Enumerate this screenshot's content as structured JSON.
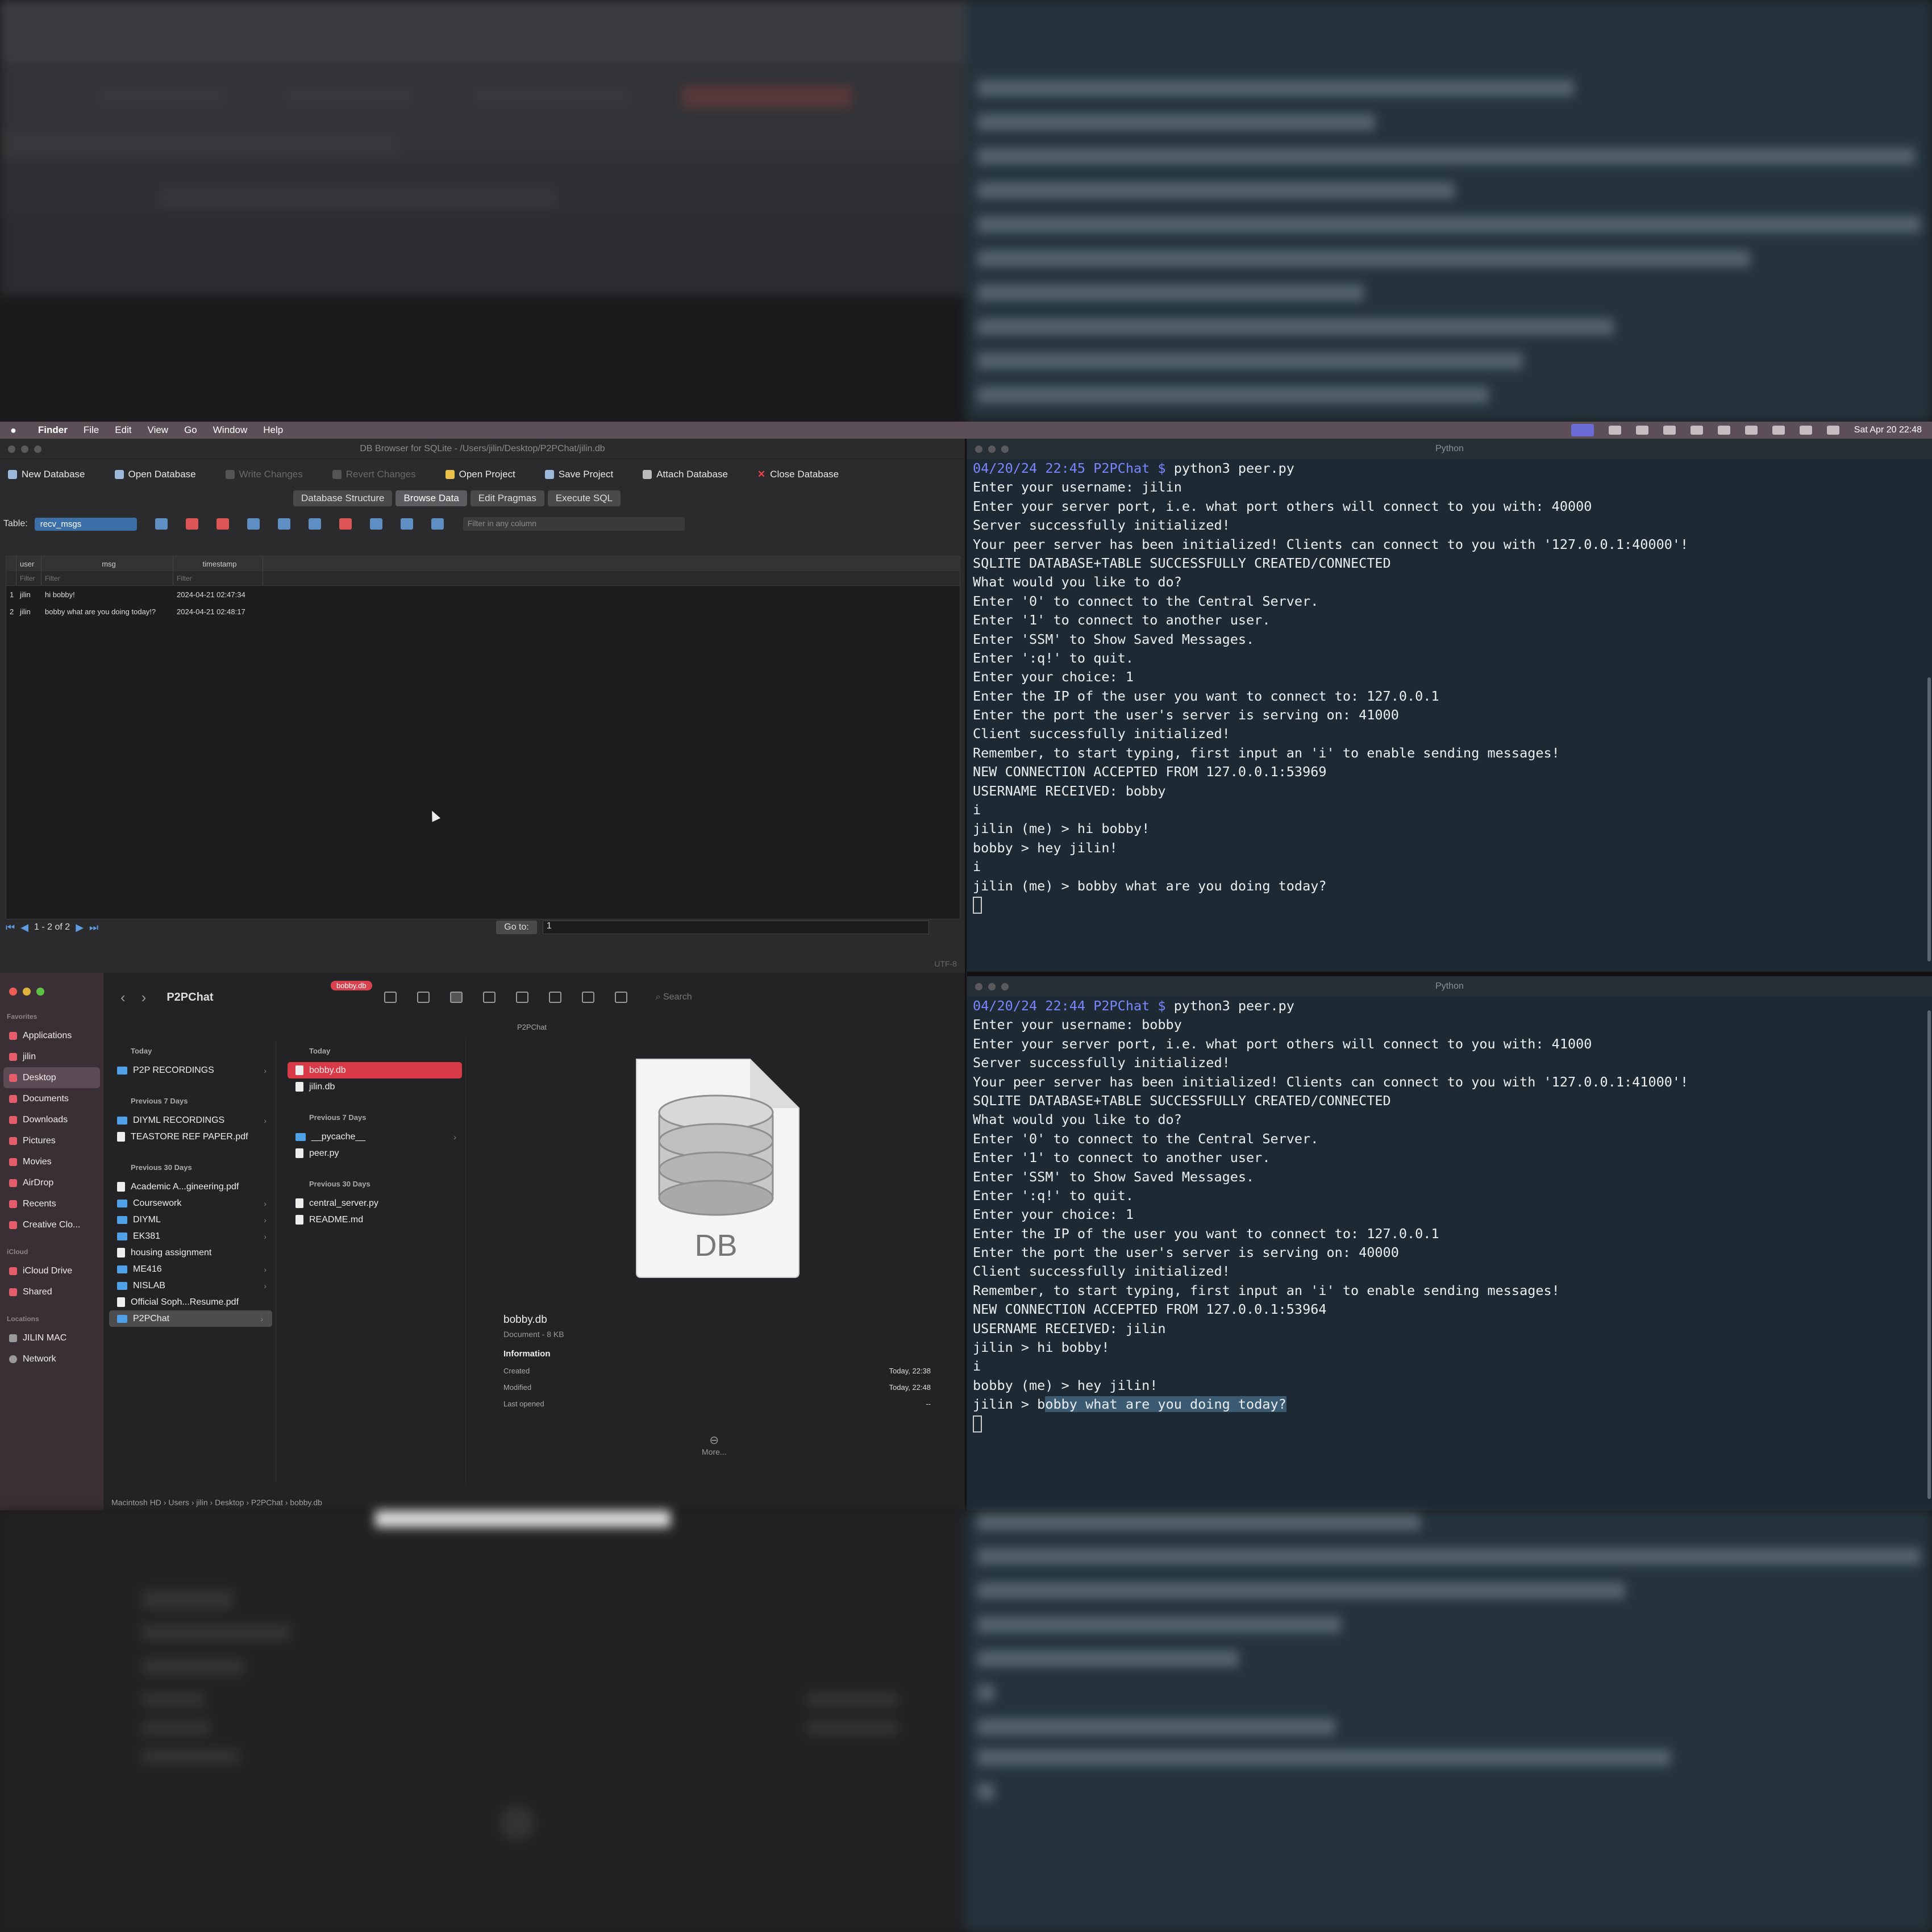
{
  "menubar": {
    "app": "Finder",
    "items": [
      "File",
      "Edit",
      "View",
      "Go",
      "Window",
      "Help"
    ],
    "datetime": "Sat Apr 20  22:48"
  },
  "db_browser": {
    "title": "DB Browser for SQLite - /Users/jilin/Desktop/P2PChat/jilin.db",
    "toolbar": [
      {
        "label": "New Database",
        "enabled": true
      },
      {
        "label": "Open Database",
        "enabled": true
      },
      {
        "label": "Write Changes",
        "enabled": false
      },
      {
        "label": "Revert Changes",
        "enabled": false
      },
      {
        "label": "Open Project",
        "enabled": true
      },
      {
        "label": "Save Project",
        "enabled": true
      },
      {
        "label": "Attach Database",
        "enabled": true
      },
      {
        "label": "Close Database",
        "enabled": true
      }
    ],
    "tabs": [
      "Database Structure",
      "Browse Data",
      "Edit Pragmas",
      "Execute SQL"
    ],
    "table_label": "Table:",
    "table_value": "recv_msgs",
    "filter_placeholder": "Filter in any column",
    "columns": [
      "user",
      "msg",
      "timestamp"
    ],
    "filter_cells": [
      "Filter",
      "Filter",
      "Filter"
    ],
    "rows": [
      {
        "n": "1",
        "user": "jilin",
        "msg": "hi bobby!",
        "timestamp": "2024-04-21 02:47:34"
      },
      {
        "n": "2",
        "user": "jilin",
        "msg": "bobby what are you doing today!?",
        "timestamp": "2024-04-21 02:48:17"
      }
    ],
    "pagination": "1 - 2 of 2",
    "goto_label": "Go to:",
    "goto_value": "1",
    "encoding": "UTF-8"
  },
  "finder": {
    "folder_title": "P2PChat",
    "tag": "bobby.db",
    "search_placeholder": "Search",
    "path_title": "P2PChat",
    "sidebar": {
      "favorites_label": "Favorites",
      "favorites": [
        "Applications",
        "jilin",
        "Desktop",
        "Documents",
        "Downloads",
        "Pictures",
        "Movies",
        "AirDrop",
        "Recents",
        "Creative Clo..."
      ],
      "icloud_label": "iCloud",
      "icloud": [
        "iCloud Drive",
        "Shared"
      ],
      "locations_label": "Locations",
      "locations": [
        "JILIN MAC",
        "Network"
      ]
    },
    "col1": {
      "today_label": "Today",
      "today": [
        "P2P RECORDINGS"
      ],
      "prev7_label": "Previous 7 Days",
      "prev7": [
        "DIYML RECORDINGS",
        "TEASTORE REF PAPER.pdf"
      ],
      "prev30_label": "Previous 30 Days",
      "prev30": [
        "Academic A...gineering.pdf",
        "Coursework",
        "DIYML",
        "EK381",
        "housing assignment",
        "ME416",
        "NISLAB",
        "Official Soph...Resume.pdf",
        "P2PChat"
      ]
    },
    "col2": {
      "today_label": "Today",
      "today": [
        "bobby.db",
        "jilin.db"
      ],
      "prev7_label": "Previous 7 Days",
      "prev7": [
        "__pycache__",
        "peer.py"
      ],
      "prev30_label": "Previous 30 Days",
      "prev30": [
        "central_server.py",
        "README.md"
      ]
    },
    "preview": {
      "icon_text": "DB",
      "name": "bobby.db",
      "kind": "Document - 8 KB",
      "info_label": "Information",
      "created_label": "Created",
      "created": "Today, 22:38",
      "modified_label": "Modified",
      "modified": "Today, 22:48",
      "opened_label": "Last opened",
      "opened": "--",
      "more": "More..."
    },
    "pathbar": [
      "Macintosh HD",
      "Users",
      "jilin",
      "Desktop",
      "P2PChat",
      "bobby.db"
    ]
  },
  "terminal1": {
    "title": "Python",
    "prompt": "04/20/24 22:45 P2PChat $",
    "command": " python3 peer.py",
    "lines": [
      "Enter your username: jilin",
      "Enter your server port, i.e. what port others will connect to you with: 40000",
      "Server successfully initialized!",
      "Your peer server has been initialized! Clients can connect to you with '127.0.0.1:40000'!",
      "SQLITE DATABASE+TABLE SUCCESSFULLY CREATED/CONNECTED",
      "What would you like to do?",
      "Enter '0' to connect to the Central Server.",
      "Enter '1' to connect to another user.",
      "Enter 'SSM' to Show Saved Messages.",
      "Enter ':q!' to quit.",
      "Enter your choice: 1",
      "Enter the IP of the user you want to connect to: 127.0.0.1",
      "Enter the port the user's server is serving on: 41000",
      "Client successfully initialized!",
      "Remember, to start typing, first input an 'i' to enable sending messages!",
      "NEW CONNECTION ACCEPTED FROM 127.0.0.1:53969",
      "USERNAME RECEIVED: bobby",
      "i",
      "jilin (me) > hi bobby!",
      "bobby > hey jilin!",
      "i",
      "jilin (me) > bobby what are you doing today?"
    ]
  },
  "terminal2": {
    "title": "Python",
    "prompt": "04/20/24 22:44 P2PChat $",
    "command": " python3 peer.py",
    "lines": [
      "Enter your username: bobby",
      "Enter your server port, i.e. what port others will connect to you with: 41000",
      "Server successfully initialized!",
      "Your peer server has been initialized! Clients can connect to you with '127.0.0.1:41000'!",
      "SQLITE DATABASE+TABLE SUCCESSFULLY CREATED/CONNECTED",
      "What would you like to do?",
      "Enter '0' to connect to the Central Server.",
      "Enter '1' to connect to another user.",
      "Enter 'SSM' to Show Saved Messages.",
      "Enter ':q!' to quit.",
      "Enter your choice: 1",
      "Enter the IP of the user you want to connect to: 127.0.0.1",
      "Enter the port the user's server is serving on: 40000",
      "Client successfully initialized!",
      "Remember, to start typing, first input an 'i' to enable sending messages!",
      "NEW CONNECTION ACCEPTED FROM 127.0.0.1:53964",
      "USERNAME RECEIVED: jilin",
      "jilin > hi bobby!",
      "i",
      "bobby (me) > hey jilin!"
    ],
    "last_prefix": "jilin > b",
    "last_highlight": "obby what are you doing today?"
  }
}
